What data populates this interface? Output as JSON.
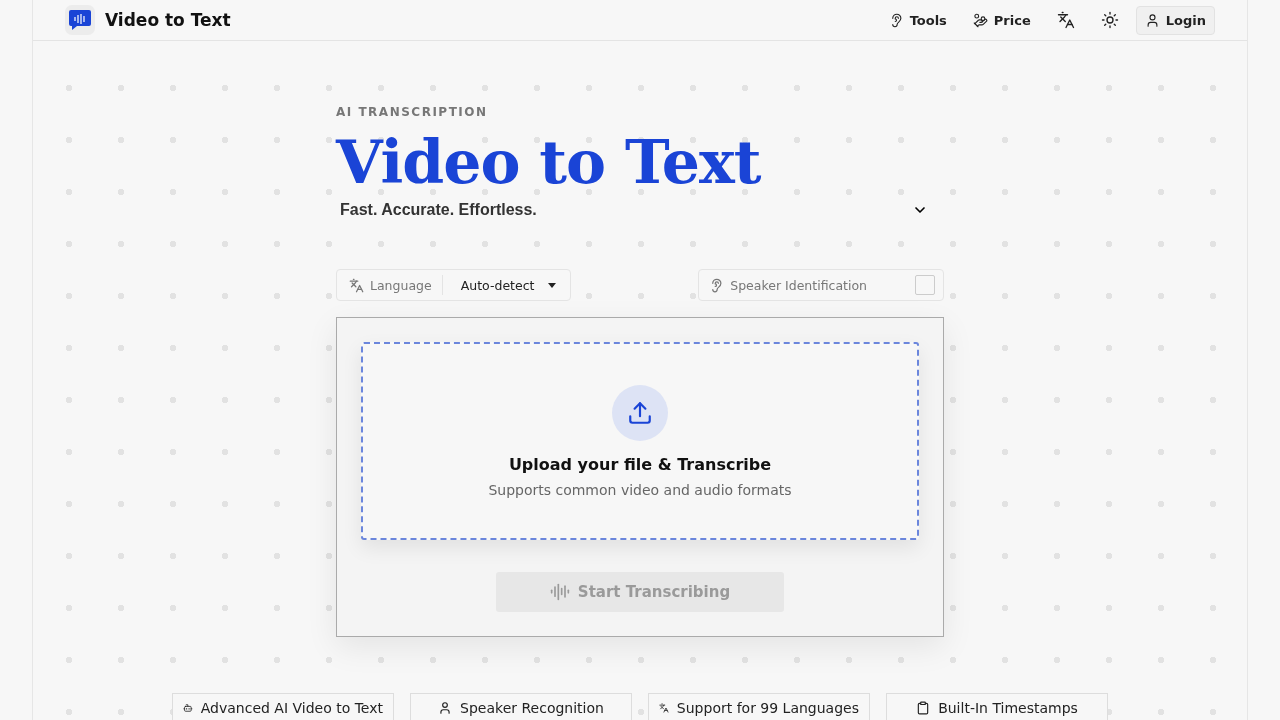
{
  "header": {
    "brand": "Video to Text",
    "nav": [
      {
        "kind": "tools",
        "label": "Tools"
      },
      {
        "kind": "price",
        "label": "Price"
      },
      {
        "kind": "translate"
      },
      {
        "kind": "theme"
      },
      {
        "kind": "login",
        "label": "Login"
      }
    ]
  },
  "hero": {
    "eyebrow": "AI TRANSCRIPTION",
    "title": "Video to Text",
    "subtitle": "Fast. Accurate. Effortless.",
    "expanded": false
  },
  "options": {
    "language_label": "Language",
    "language_value": "Auto-detect",
    "speaker_label": "Speaker Identification",
    "speaker_checked": false
  },
  "upload": {
    "title": "Upload your file & Transcribe",
    "hint": "Supports common video and audio formats"
  },
  "start_button": {
    "label": "Start Transcribing",
    "disabled": true
  },
  "features": [
    {
      "kind": "robot",
      "label": "Advanced AI Video to Text"
    },
    {
      "kind": "speaker",
      "label": "Speaker Recognition"
    },
    {
      "kind": "translate",
      "label": "Support for 99 Languages"
    },
    {
      "kind": "clipboard",
      "label": "Built-In Timestamps"
    }
  ]
}
